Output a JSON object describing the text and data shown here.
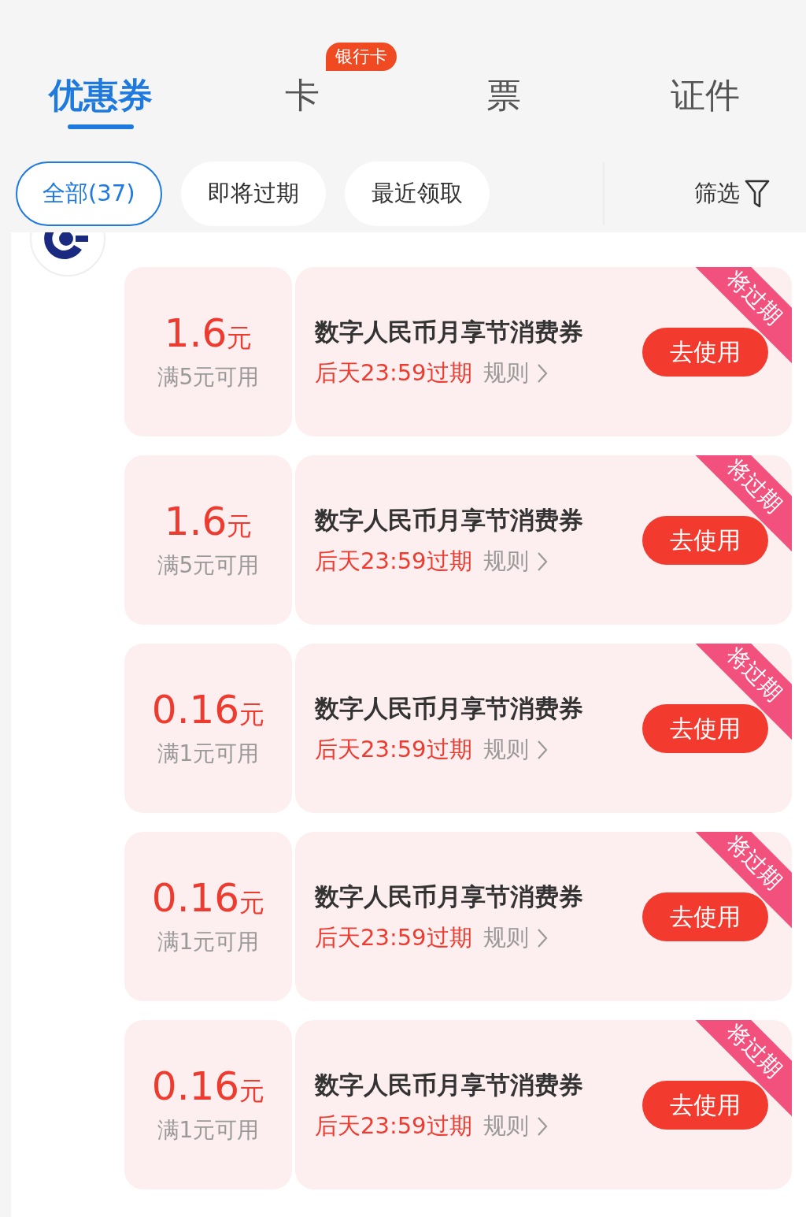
{
  "tabs": [
    {
      "label": "优惠券",
      "selected": true
    },
    {
      "label": "卡",
      "selected": false,
      "badge": "银行卡"
    },
    {
      "label": "票",
      "selected": false
    },
    {
      "label": "证件",
      "selected": false
    }
  ],
  "chips": [
    {
      "label": "全部(37)",
      "selected": true
    },
    {
      "label": "即将过期",
      "selected": false
    },
    {
      "label": "最近领取",
      "selected": false
    }
  ],
  "filter": {
    "label": "筛选"
  },
  "coupons": [
    {
      "amount": "1.6",
      "unit": "元",
      "condition": "满5元可用",
      "title": "数字人民币月享节消费券",
      "expiry": "后天23:59过期",
      "rules": "规则",
      "button": "去使用",
      "ribbon": "将过期"
    },
    {
      "amount": "1.6",
      "unit": "元",
      "condition": "满5元可用",
      "title": "数字人民币月享节消费券",
      "expiry": "后天23:59过期",
      "rules": "规则",
      "button": "去使用",
      "ribbon": "将过期"
    },
    {
      "amount": "0.16",
      "unit": "元",
      "condition": "满1元可用",
      "title": "数字人民币月享节消费券",
      "expiry": "后天23:59过期",
      "rules": "规则",
      "button": "去使用",
      "ribbon": "将过期"
    },
    {
      "amount": "0.16",
      "unit": "元",
      "condition": "满1元可用",
      "title": "数字人民币月享节消费券",
      "expiry": "后天23:59过期",
      "rules": "规则",
      "button": "去使用",
      "ribbon": "将过期"
    },
    {
      "amount": "0.16",
      "unit": "元",
      "condition": "满1元可用",
      "title": "数字人民币月享节消费券",
      "expiry": "后天23:59过期",
      "rules": "规则",
      "button": "去使用",
      "ribbon": "将过期"
    }
  ]
}
